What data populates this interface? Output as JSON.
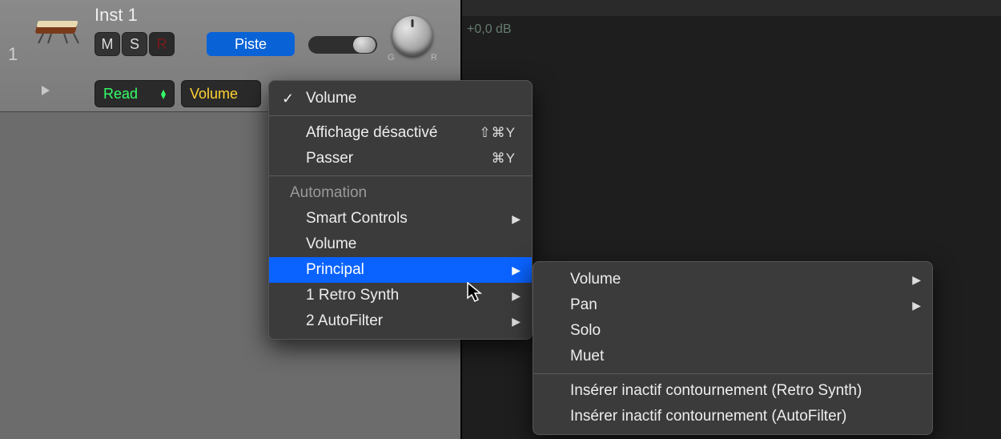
{
  "arrange": {
    "db_label": "+0,0 dB"
  },
  "track": {
    "number": "1",
    "name": "Inst 1",
    "mute": "M",
    "solo": "S",
    "record": "R",
    "track_button": "Piste",
    "knob_left_label": "G",
    "knob_right_label": "R",
    "automation_mode": "Read",
    "parameter": "Volume"
  },
  "menu1": {
    "volume": "Volume",
    "display_off": {
      "label": "Affichage désactivé",
      "shortcut": "⇧⌘Y"
    },
    "pass": {
      "label": "Passer",
      "shortcut": "⌘Y"
    },
    "section": "Automation",
    "smart_controls": "Smart Controls",
    "volume2": "Volume",
    "principal": "Principal",
    "retro": "1 Retro Synth",
    "autofilter": "2 AutoFilter"
  },
  "menu2": {
    "volume": "Volume",
    "pan": "Pan",
    "solo": "Solo",
    "mute": "Muet",
    "bypass1": "Insérer inactif contournement (Retro Synth)",
    "bypass2": "Insérer inactif contournement (AutoFilter)"
  }
}
